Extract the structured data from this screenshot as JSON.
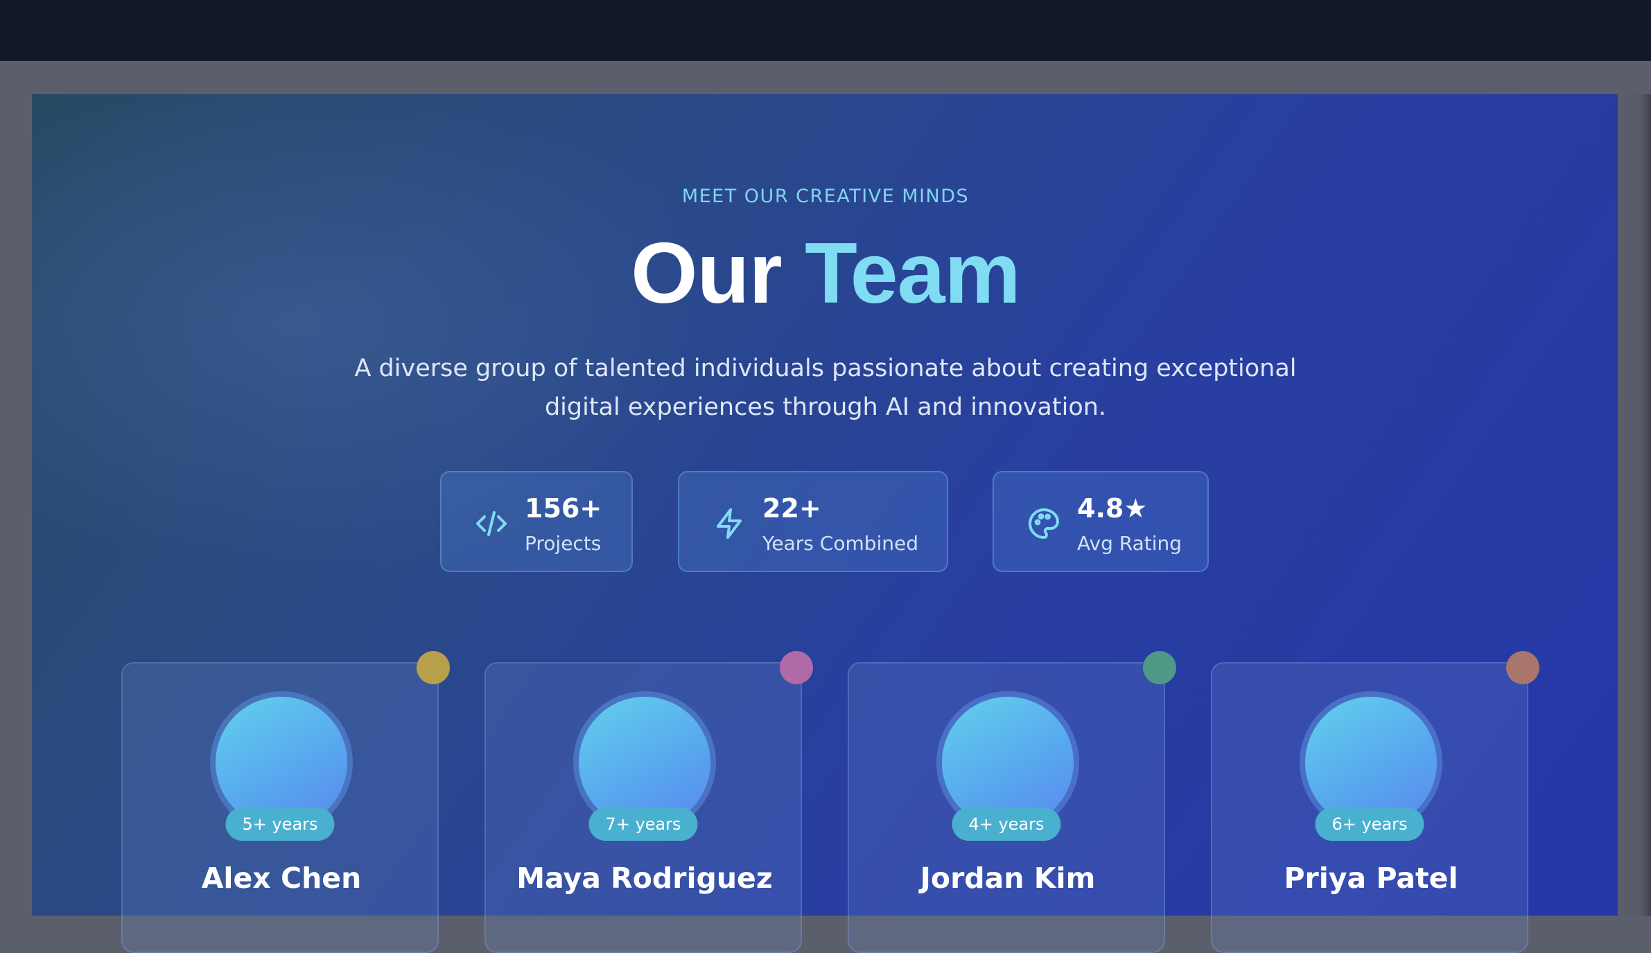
{
  "hero": {
    "eyebrow": "MEET OUR CREATIVE MINDS",
    "title_part1": "Our",
    "title_part2": "Team",
    "subtitle_line1": "A diverse group of talented individuals passionate about creating exceptional",
    "subtitle_line2": "digital experiences through AI and innovation."
  },
  "stats": [
    {
      "icon": "code-icon",
      "value": "156+",
      "label": "Projects"
    },
    {
      "icon": "lightning-icon",
      "value": "22+",
      "label": "Years Combined"
    },
    {
      "icon": "palette-icon",
      "value": "4.8★",
      "label": "Avg Rating"
    }
  ],
  "team": [
    {
      "name": "Alex Chen",
      "experience": "5+ years",
      "accent_color": "#b8a04a"
    },
    {
      "name": "Maya Rodriguez",
      "experience": "7+ years",
      "accent_color": "#b06aa8"
    },
    {
      "name": "Jordan Kim",
      "experience": "4+ years",
      "accent_color": "#4f9a86"
    },
    {
      "name": "Priya Patel",
      "experience": "6+ years",
      "accent_color": "#a8766a"
    }
  ],
  "colors": {
    "accent": "#7fdcf2",
    "badge": "#4ab0cf",
    "page_background": "#2a4090"
  }
}
